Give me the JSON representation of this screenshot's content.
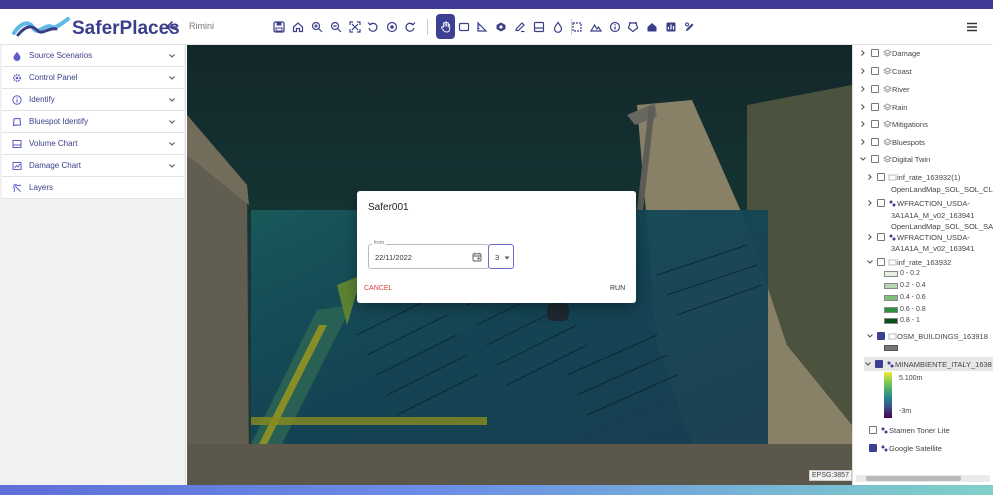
{
  "app": {
    "name": "SaferPlaces",
    "place": "Rimini"
  },
  "toolbar": {
    "groups": [
      [
        "save-icon",
        "home-icon",
        "zoom-in-icon",
        "zoom-out-icon",
        "fit-icon",
        "rotate-left-icon",
        "center-icon",
        "rotate-right-icon"
      ],
      [
        "hand-icon",
        "rectangle-icon",
        "ruler-icon",
        "layer-shape-icon",
        "edit-icon",
        "floppy-layer-icon",
        "drop-icon",
        "crop-icon",
        "terrain-icon",
        "info-icon",
        "polygon-icon",
        "house-icon",
        "chart-icon",
        "edit-pen-icon"
      ]
    ]
  },
  "sidebar": {
    "items": [
      {
        "label": "Source Scenarios",
        "icon": "drop-icon",
        "expandable": true
      },
      {
        "label": "Control Panel",
        "icon": "gear-icon",
        "expandable": true
      },
      {
        "label": "Identify",
        "icon": "info-icon",
        "expandable": true
      },
      {
        "label": "Bluespot Identify",
        "icon": "bluespot-icon",
        "expandable": true
      },
      {
        "label": "Volume Chart",
        "icon": "volume-icon",
        "expandable": true
      },
      {
        "label": "Damage Chart",
        "icon": "damage-icon",
        "expandable": true
      },
      {
        "label": "Layers",
        "icon": "layers-icon",
        "expandable": false
      }
    ]
  },
  "dialog": {
    "title": "Safer001",
    "from_label": "from",
    "date_value": "22/11/2022",
    "number_value": "3",
    "cancel_label": "CANCEL",
    "run_label": "RUN"
  },
  "layers": {
    "groups": [
      {
        "label": "Damage"
      },
      {
        "label": "Coast"
      },
      {
        "label": "River"
      },
      {
        "label": "Rain"
      },
      {
        "label": "Mitigations"
      },
      {
        "label": "Bluespots"
      },
      {
        "label": "Digital Twin"
      }
    ],
    "sub": {
      "inf1": "inf_rate_163932(1)",
      "osl1_line1": "OpenLandMap_SOL_SOL_CL",
      "osl1_line2": "WFRACTION_USDA-",
      "osl1_line3": "3A1A1A_M_v02_163941",
      "osl2_line1": "OpenLandMap_SOL_SOL_SA",
      "osl2_line2": "WFRACTION_USDA-",
      "osl2_line3": "3A1A1A_M_v02_163941",
      "inf2": "inf_rate_163932",
      "osm": "OSM_BUILDINGS_163918",
      "mina": "MINAMBIENTE_ITALY_1638",
      "stamen": "Stamen Toner Lite",
      "google": "Google Satellite"
    },
    "legend": [
      "0 - 0.2",
      "0.2 - 0.4",
      "0.4 - 0.6",
      "0.6 - 0.8",
      "0.8 - 1"
    ],
    "legend_colors": [
      "#e8f0e4",
      "#b9d6b0",
      "#7fbf7a",
      "#2f8f3c",
      "#0b4d1b"
    ],
    "dem_max": "5.100m",
    "dem_min": "-3m"
  },
  "map": {
    "crs": "EPSG:3857"
  },
  "colors": {
    "brand": "#3b3f8a",
    "accent": "#3d3f92",
    "cancel": "#d0423a"
  }
}
